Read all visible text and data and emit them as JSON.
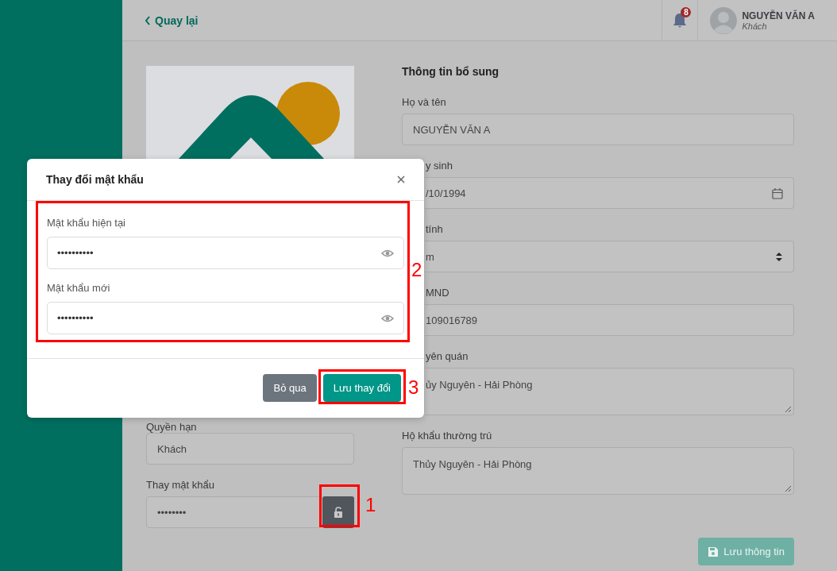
{
  "top_bar": {
    "back_link": "Quay lại",
    "notifications": {
      "count": "8"
    },
    "user": {
      "name": "NGUYỄN VĂN A",
      "role": "Khách"
    }
  },
  "profile": {
    "left": {
      "fields": [
        {
          "label": "Quyền hạn",
          "value": "Khách",
          "kind": "text"
        },
        {
          "label": "Thay mật khẩu",
          "value": "••••••••",
          "kind": "password"
        }
      ]
    },
    "right": {
      "title": "Thông tin bổ sung",
      "fields": [
        {
          "label": "Họ và tên",
          "value": "NGUYỄN VĂN A",
          "kind": "text",
          "partly_covered": false
        },
        {
          "label": "y sinh",
          "value": "/10/1994",
          "kind": "date",
          "partly_covered": true
        },
        {
          "label": "tính",
          "value": "m",
          "kind": "select",
          "partly_covered": true
        },
        {
          "label": "MND",
          "value": "109016789",
          "kind": "text",
          "partly_covered": true
        },
        {
          "label": "yên quán",
          "value": "ủy Nguyên - Hải Phòng",
          "kind": "textarea",
          "partly_covered": true
        },
        {
          "label": "Hộ khẩu thường trú",
          "value": "Thủy Nguyên - Hải Phòng",
          "kind": "textarea",
          "partly_covered": false
        }
      ],
      "save_button": "Lưu thông tin"
    }
  },
  "modal": {
    "title": "Thay đổi mật khẩu",
    "fields": [
      {
        "label": "Mật khẩu hiện tại",
        "value": "••••••••••"
      },
      {
        "label": "Mật khẩu mới",
        "value": "••••••••••"
      }
    ],
    "buttons": [
      {
        "label": "Bỏ qua",
        "kind": "secondary"
      },
      {
        "label": "Lưu thay đổi",
        "kind": "primary"
      }
    ]
  },
  "annotations": [
    {
      "number": "1",
      "kind": "lock"
    },
    {
      "number": "2",
      "kind": "fields"
    },
    {
      "number": "3",
      "kind": "save"
    }
  ]
}
